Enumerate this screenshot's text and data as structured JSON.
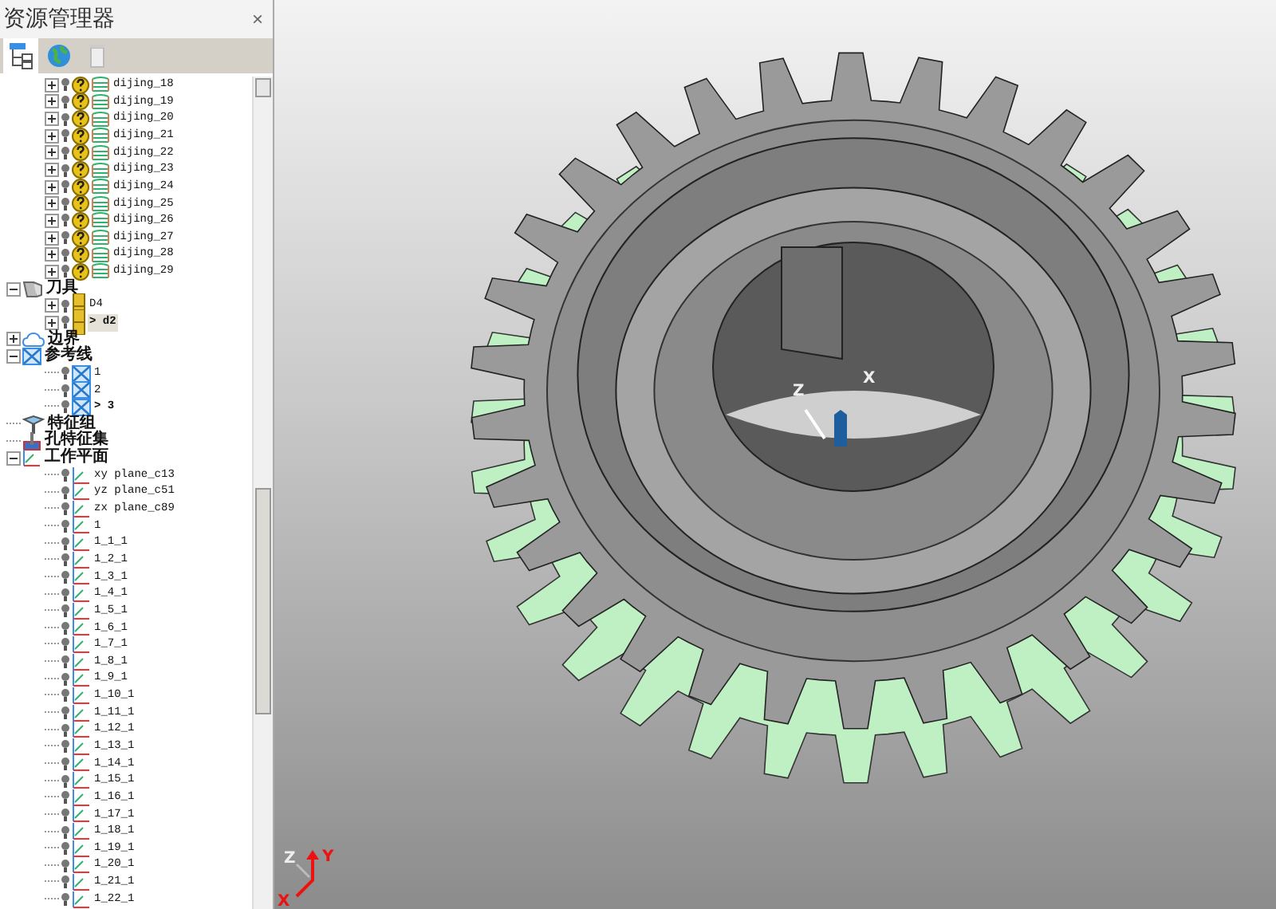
{
  "panel": {
    "title": "资源管理器",
    "close": "×"
  },
  "toolbar": [
    {
      "kind": "tree",
      "selected": true
    },
    {
      "kind": "globe",
      "selected": false
    },
    {
      "kind": "trash",
      "selected": false
    }
  ],
  "partial_group": [
    {
      "label": "dijing_18",
      "expanded": false
    },
    {
      "label": "dijing_19",
      "expanded": false
    },
    {
      "label": "dijing_20",
      "expanded": false
    },
    {
      "label": "dijing_21",
      "expanded": false
    },
    {
      "label": "dijing_22",
      "expanded": false
    },
    {
      "label": "dijing_23",
      "expanded": false
    },
    {
      "label": "dijing_24",
      "expanded": false
    },
    {
      "label": "dijing_25",
      "expanded": false
    },
    {
      "label": "dijing_26",
      "expanded": false
    },
    {
      "label": "dijing_27",
      "expanded": false
    },
    {
      "label": "dijing_28",
      "expanded": false
    },
    {
      "label": "dijing_29",
      "expanded": false
    }
  ],
  "tree": [
    {
      "label": "刀具",
      "kind": "tools",
      "expanded": true,
      "children": [
        {
          "label": "D4",
          "kind": "tool",
          "expanded": false,
          "active": false,
          "selected": false
        },
        {
          "label": "> d2",
          "kind": "tool",
          "expanded": false,
          "active": true,
          "selected": true
        }
      ]
    },
    {
      "label": "边界",
      "kind": "boundary",
      "expanded": false
    },
    {
      "label": "参考线",
      "kind": "reflines",
      "expanded": true,
      "children": [
        {
          "label": "1",
          "kind": "refline",
          "active": false
        },
        {
          "label": "2",
          "kind": "refline",
          "active": false
        },
        {
          "label": "> 3",
          "kind": "refline",
          "active": true
        }
      ]
    },
    {
      "label": "特征组",
      "kind": "featureset"
    },
    {
      "label": "孔特征集",
      "kind": "holes"
    },
    {
      "label": "工作平面",
      "kind": "workplanes",
      "expanded": true,
      "children": [
        {
          "label": "xy plane_c13",
          "kind": "plane"
        },
        {
          "label": "yz plane_c51",
          "kind": "plane"
        },
        {
          "label": "zx plane_c89",
          "kind": "plane"
        },
        {
          "label": "1",
          "kind": "plane"
        },
        {
          "label": "1_1_1",
          "kind": "plane"
        },
        {
          "label": "1_2_1",
          "kind": "plane"
        },
        {
          "label": "1_3_1",
          "kind": "plane"
        },
        {
          "label": "1_4_1",
          "kind": "plane"
        },
        {
          "label": "1_5_1",
          "kind": "plane"
        },
        {
          "label": "1_6_1",
          "kind": "plane"
        },
        {
          "label": "1_7_1",
          "kind": "plane"
        },
        {
          "label": "1_8_1",
          "kind": "plane"
        },
        {
          "label": "1_9_1",
          "kind": "plane"
        },
        {
          "label": "1_10_1",
          "kind": "plane"
        },
        {
          "label": "1_11_1",
          "kind": "plane"
        },
        {
          "label": "1_12_1",
          "kind": "plane"
        },
        {
          "label": "1_13_1",
          "kind": "plane"
        },
        {
          "label": "1_14_1",
          "kind": "plane"
        },
        {
          "label": "1_15_1",
          "kind": "plane"
        },
        {
          "label": "1_16_1",
          "kind": "plane"
        },
        {
          "label": "1_17_1",
          "kind": "plane"
        },
        {
          "label": "1_18_1",
          "kind": "plane"
        },
        {
          "label": "1_19_1",
          "kind": "plane"
        },
        {
          "label": "1_20_1",
          "kind": "plane"
        },
        {
          "label": "1_21_1",
          "kind": "plane"
        },
        {
          "label": "1_22_1",
          "kind": "plane"
        }
      ]
    }
  ],
  "viewport": {
    "model_axes": {
      "z": "Z",
      "x": "X"
    },
    "view_axes": {
      "z": "Z",
      "y": "Y",
      "x": "X"
    }
  }
}
